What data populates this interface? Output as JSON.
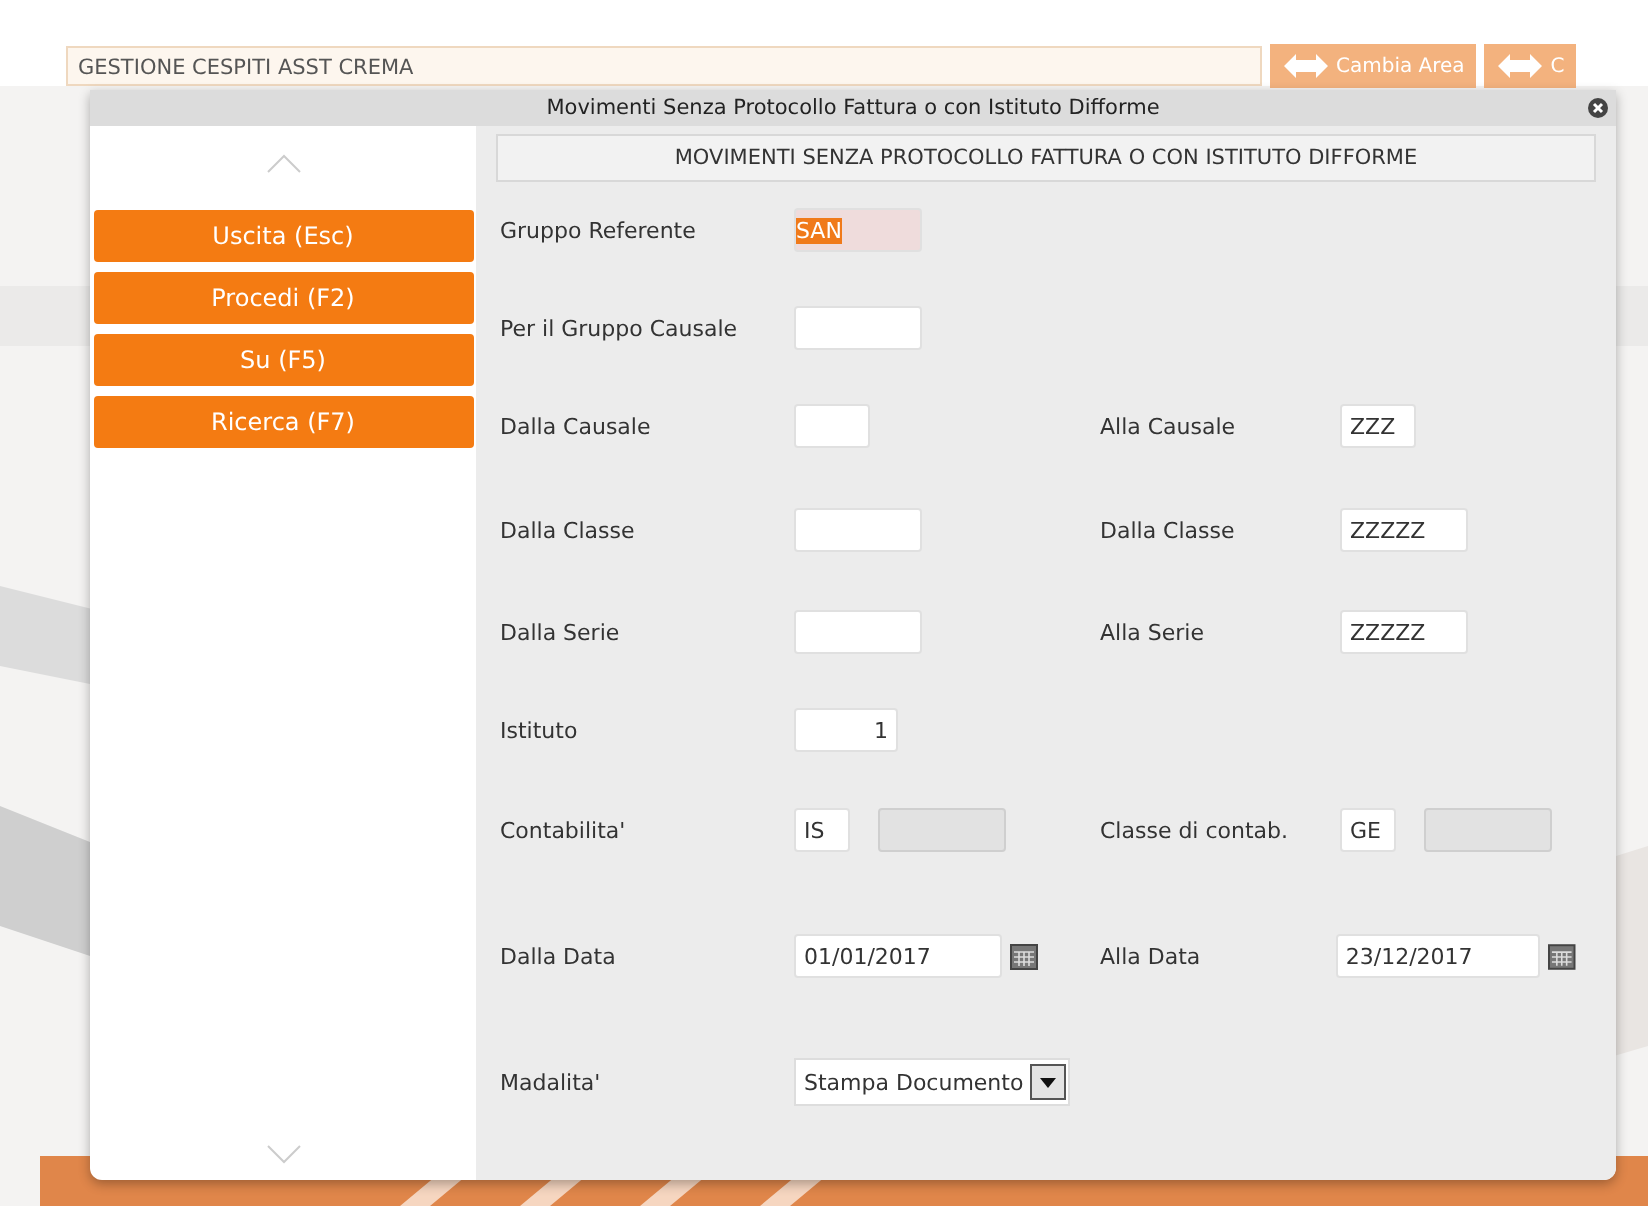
{
  "header": {
    "area": "GESTIONE CESPITI ASST CREMA",
    "buttons": [
      "Cambia Area",
      "C"
    ]
  },
  "dialog": {
    "title": "Movimenti Senza Protocollo Fattura o con Istituto Difforme",
    "heading": "MOVIMENTI SENZA PROTOCOLLO FATTURA O CON ISTITUTO DIFFORME",
    "actions": [
      "Uscita (Esc)",
      "Procedi (F2)",
      "Su (F5)",
      "Ricerca (F7)"
    ],
    "rows": [
      {
        "left": {
          "label": "Gruppo Referente",
          "fields": [
            {
              "kind": "text",
              "value": "SAN",
              "text_selected": true,
              "disabled": false
            }
          ]
        }
      },
      {
        "left": {
          "label": "Per il Gruppo Causale",
          "fields": [
            {
              "kind": "text",
              "disabled": false
            }
          ]
        }
      },
      {
        "left": {
          "label": "Dalla Causale",
          "fields": [
            {
              "kind": "short",
              "disabled": false
            }
          ]
        },
        "right": {
          "label": "Alla Causale",
          "fields": [
            {
              "kind": "short",
              "value": "ZZZ",
              "disabled": false
            }
          ]
        }
      },
      {
        "left": {
          "label": "Dalla Classe",
          "fields": [
            {
              "kind": "text",
              "disabled": false
            }
          ]
        },
        "right": {
          "label": "Dalla Classe",
          "fields": [
            {
              "kind": "text",
              "value": "ZZZZZ",
              "disabled": false
            }
          ]
        }
      },
      {
        "left": {
          "label": "Dalla Serie",
          "fields": [
            {
              "kind": "text",
              "disabled": false
            }
          ]
        },
        "right": {
          "label": "Alla Serie",
          "fields": [
            {
              "kind": "text",
              "value": "ZZZZZ",
              "disabled": false
            }
          ]
        }
      },
      {
        "left": {
          "label": "Istituto",
          "fields": [
            {
              "kind": "number",
              "value": "1",
              "disabled": false
            }
          ]
        }
      },
      {
        "left": {
          "label": "Contabilita'",
          "fields": [
            {
              "kind": "tiny",
              "value": "IS",
              "disabled": false
            },
            {
              "kind": "text",
              "disabled": true
            }
          ]
        },
        "right": {
          "label": "Classe di contab.",
          "fields": [
            {
              "kind": "tiny",
              "value": "GE",
              "disabled": false
            },
            {
              "kind": "text",
              "disabled": true
            }
          ]
        }
      },
      {
        "left": {
          "label": "Dalla Data",
          "fields": [
            {
              "kind": "date",
              "value": "01/01/2017"
            }
          ]
        },
        "right": {
          "label": "Alla Data",
          "fields": [
            {
              "kind": "date",
              "value": "23/12/2017"
            }
          ]
        }
      },
      {
        "left": {
          "label": "Madalita'",
          "fields": [
            {
              "kind": "select",
              "value": "Stampa Documento"
            }
          ]
        }
      }
    ]
  }
}
